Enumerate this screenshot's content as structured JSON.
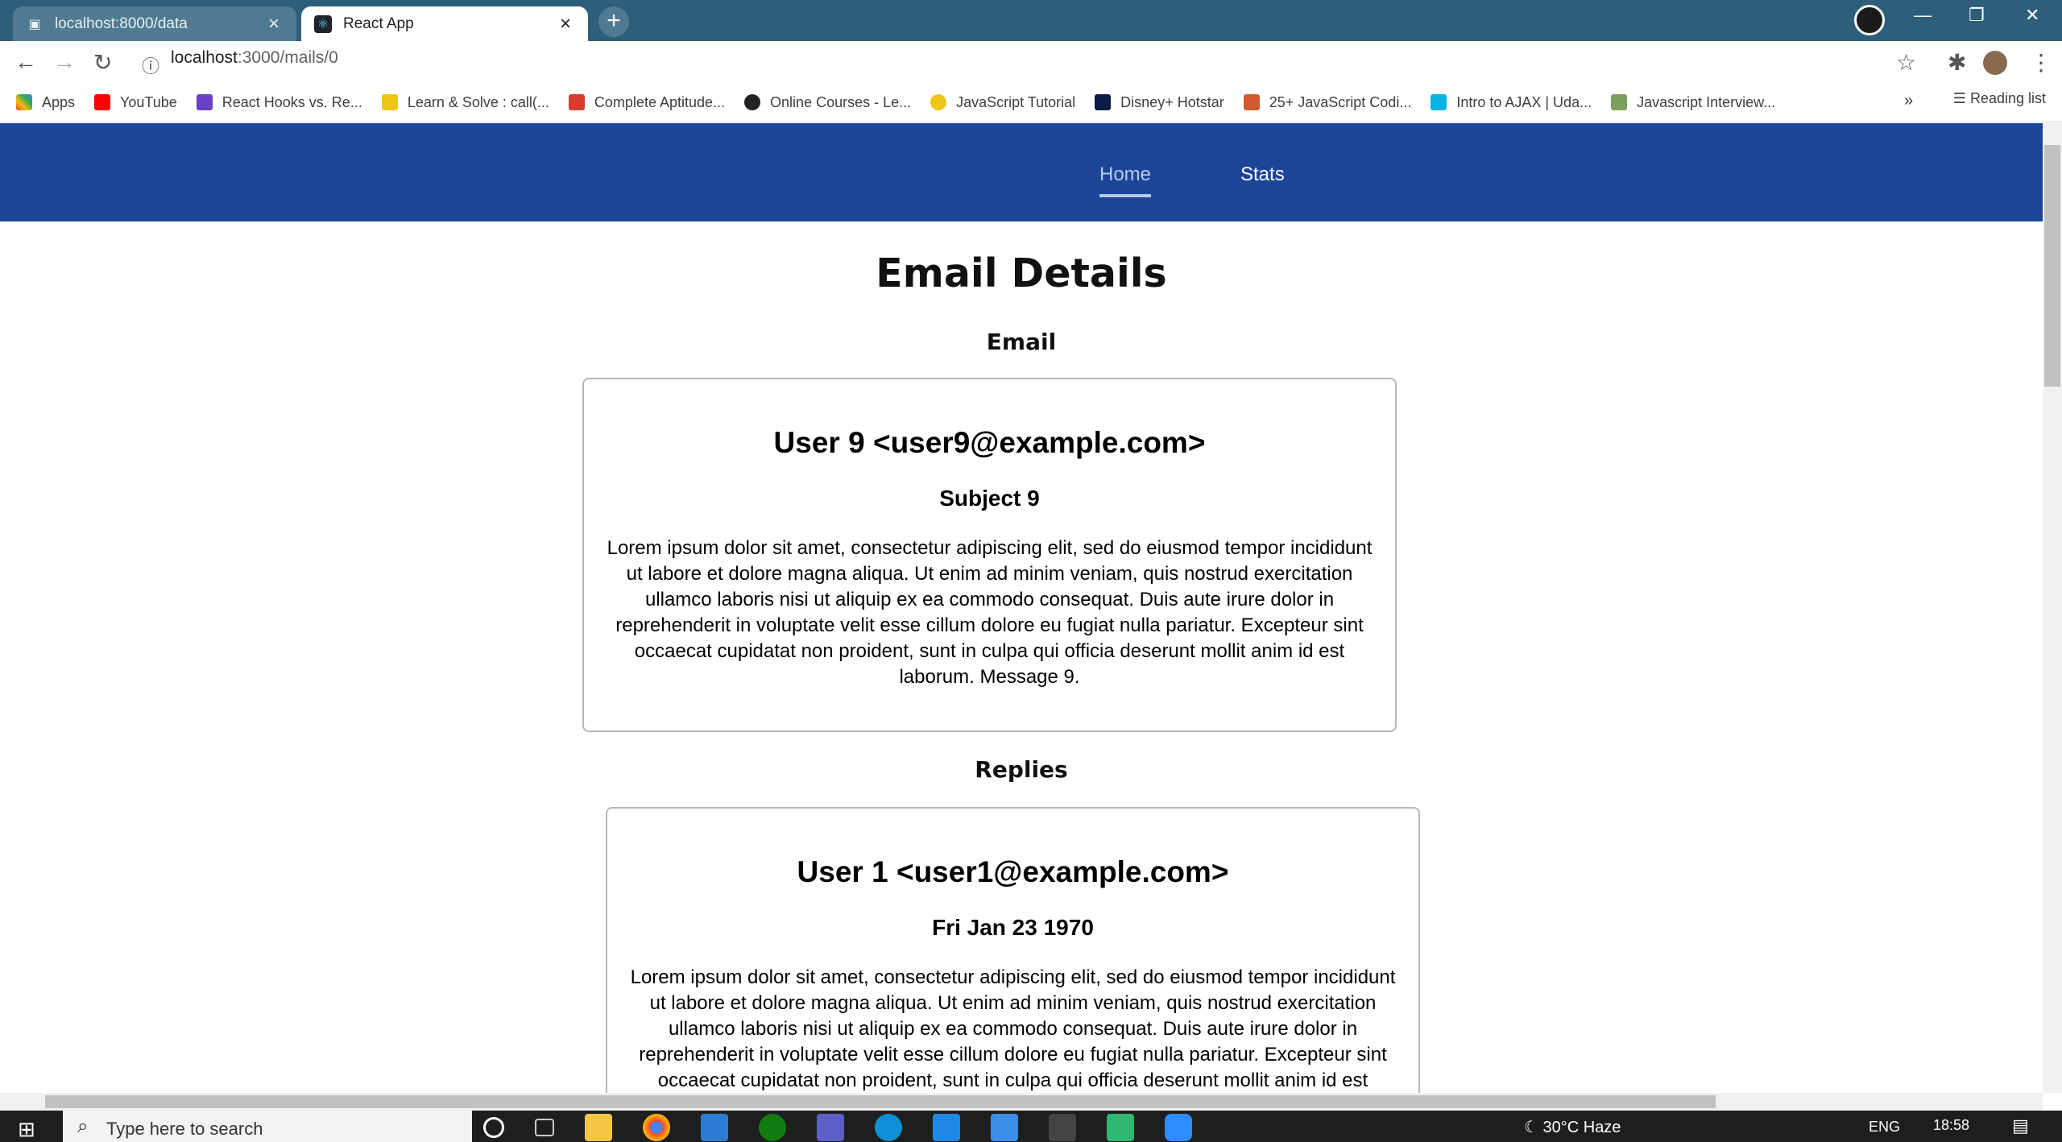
{
  "browser": {
    "tabs": [
      {
        "label": "localhost:8000/data",
        "active": false
      },
      {
        "label": "React App",
        "active": true
      }
    ],
    "url_host": "localhost",
    "url_path": ":3000/mails/0",
    "bookmarks": [
      {
        "label": "Apps",
        "color": "#e8453c"
      },
      {
        "label": "YouTube",
        "color": "#ff0000"
      },
      {
        "label": "React Hooks vs. Re...",
        "color": "#6b3fc7"
      },
      {
        "label": "Learn & Solve : call(...",
        "color": "#f0c419"
      },
      {
        "label": "Complete Aptitude...",
        "color": "#d93b2f"
      },
      {
        "label": "Online Courses - Le...",
        "color": "#222222"
      },
      {
        "label": "JavaScript Tutorial",
        "color": "#f0c419"
      },
      {
        "label": "Disney+ Hotstar",
        "color": "#0b1c47"
      },
      {
        "label": "25+ JavaScript Codi...",
        "color": "#d35a2f"
      },
      {
        "label": "Intro to AJAX | Uda...",
        "color": "#02b3e4"
      },
      {
        "label": "Javascript Interview...",
        "color": "#7ba05b"
      }
    ],
    "overflow_label": "»",
    "reading_list": "Reading list"
  },
  "app": {
    "nav": {
      "home": "Home",
      "stats": "Stats"
    },
    "page_title": "Email Details",
    "email_section_title": "Email",
    "email": {
      "from": "User 9 <user9@example.com>",
      "subject": "Subject 9",
      "body": "Lorem ipsum dolor sit amet, consectetur adipiscing elit, sed do eiusmod tempor incididunt ut labore et dolore magna aliqua. Ut enim ad minim veniam, quis nostrud exercitation ullamco laboris nisi ut aliquip ex ea commodo consequat. Duis aute irure dolor in reprehenderit in voluptate velit esse cillum dolore eu fugiat nulla pariatur. Excepteur sint occaecat cupidatat non proident, sunt in culpa qui officia deserunt mollit anim id est laborum. Message 9."
    },
    "replies_section_title": "Replies",
    "replies": [
      {
        "from": "User 1 <user1@example.com>",
        "date": "Fri Jan 23 1970",
        "body": "Lorem ipsum dolor sit amet, consectetur adipiscing elit, sed do eiusmod tempor incididunt ut labore et dolore magna aliqua. Ut enim ad minim veniam, quis nostrud exercitation ullamco laboris nisi ut aliquip ex ea commodo consequat. Duis aute irure dolor in reprehenderit in voluptate velit esse cillum dolore eu fugiat nulla pariatur. Excepteur sint occaecat cupidatat non proident, sunt in culpa qui officia deserunt mollit anim id est"
      }
    ]
  },
  "taskbar": {
    "search_placeholder": "Type here to search",
    "weather": "30°C  Haze",
    "lang": "ENG",
    "time": "18:58"
  }
}
